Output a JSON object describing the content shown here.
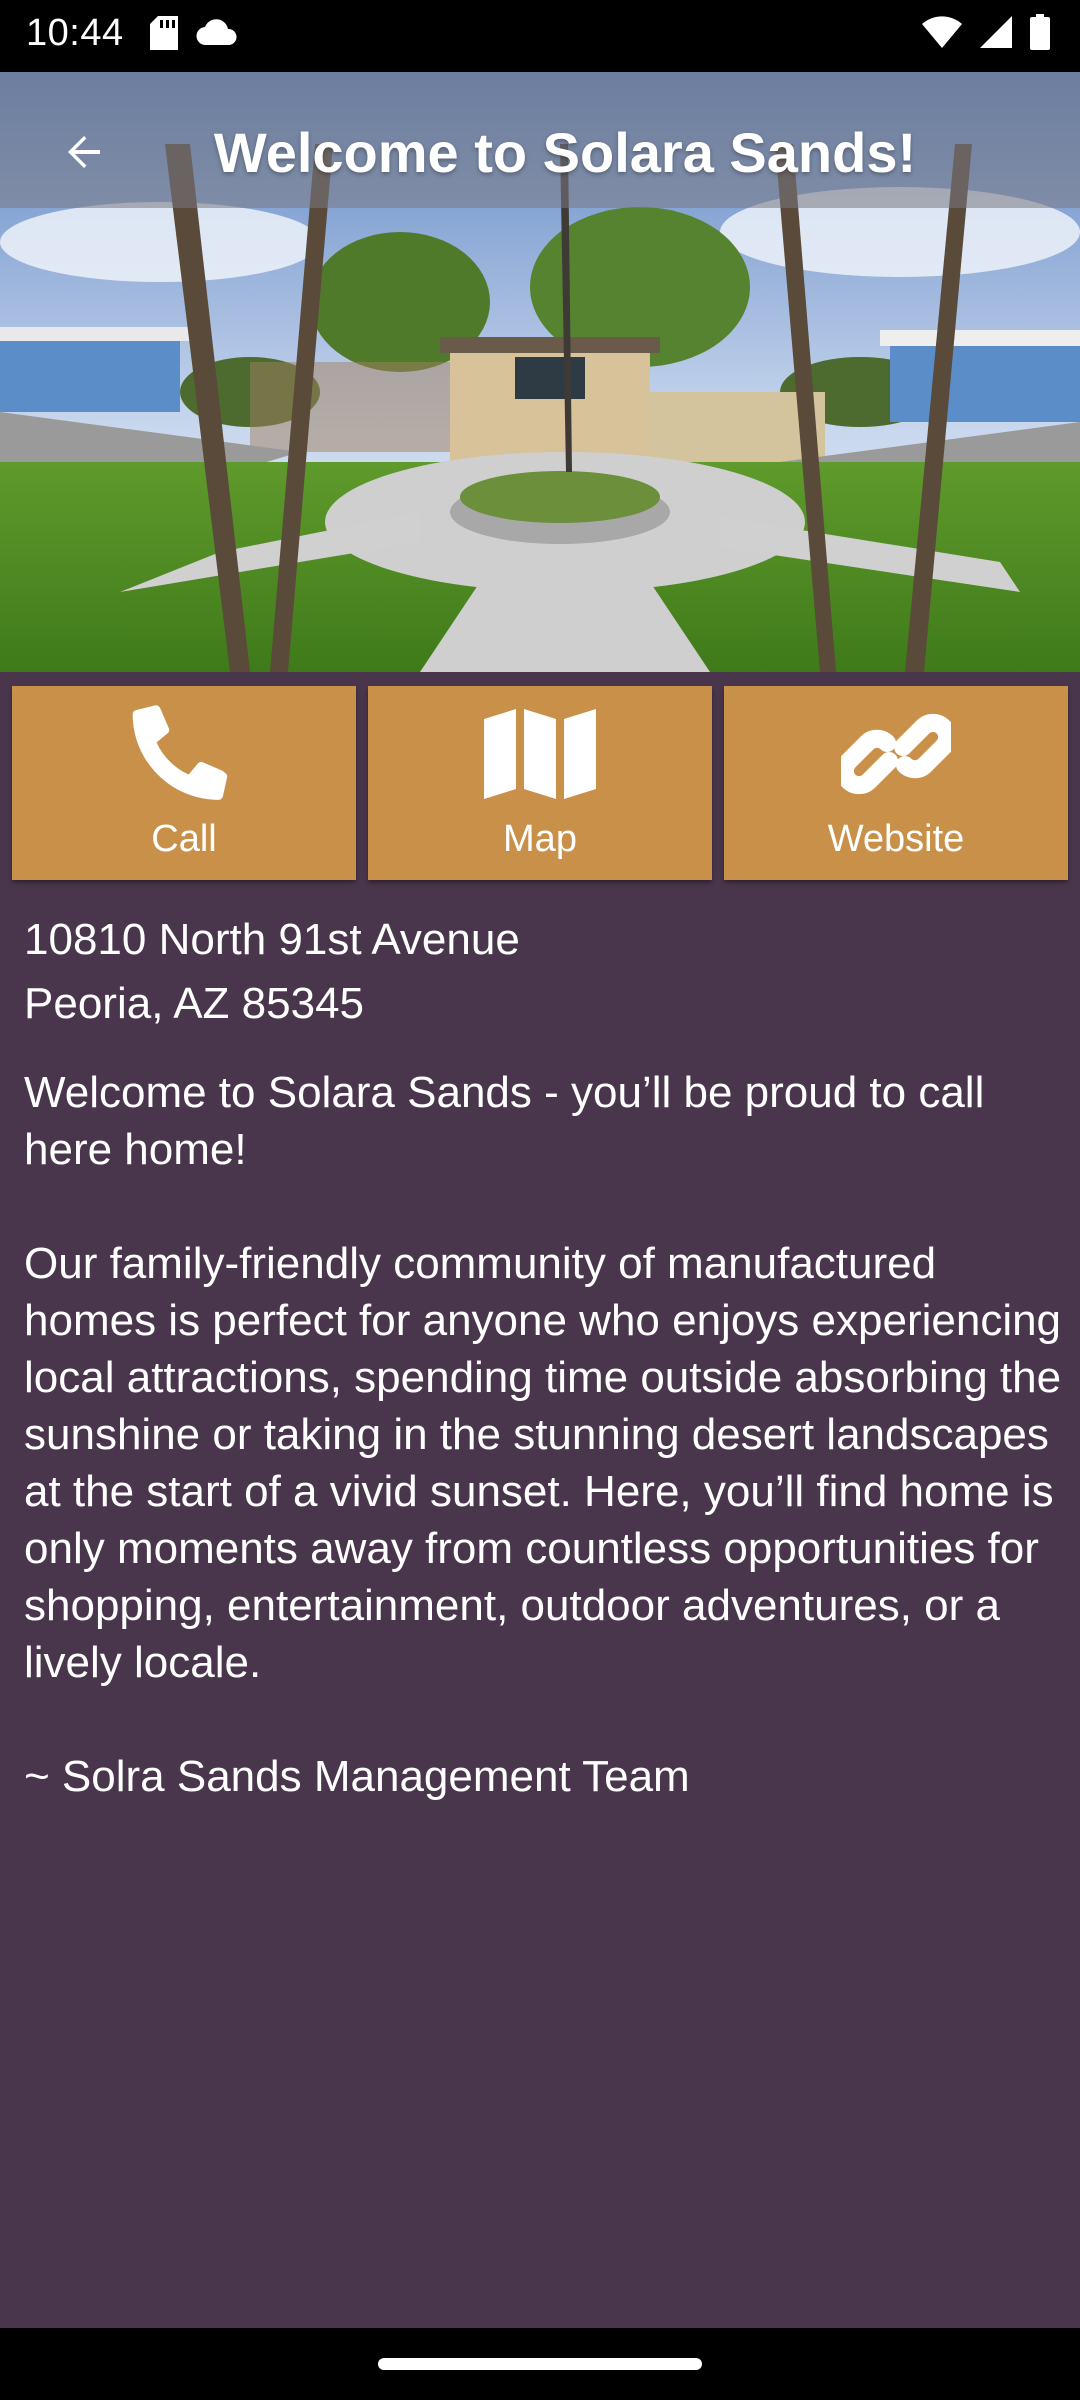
{
  "status_bar": {
    "time": "10:44",
    "icons": [
      "sd-card-icon",
      "cloud-icon",
      "wifi-icon",
      "signal-icon",
      "battery-icon"
    ]
  },
  "app_bar": {
    "title": "Welcome to Solara Sands!",
    "back_icon": "arrow-back-icon"
  },
  "hero": {
    "image": "community-entrance-photo"
  },
  "actions": [
    {
      "label": "Call",
      "icon": "phone-icon"
    },
    {
      "label": "Map",
      "icon": "map-icon"
    },
    {
      "label": "Website",
      "icon": "link-icon"
    }
  ],
  "address": {
    "line1": "10810 North 91st Avenue",
    "line2": "Peoria, AZ 85345"
  },
  "description": {
    "intro": "Welcome to Solara Sands - you’ll be proud to call here home!",
    "body": "Our family-friendly community of manufactured homes is perfect for anyone who enjoys experiencing local attractions, spending time outside absorbing the sunshine or taking in the stunning desert landscapes at the start of a vivid sunset. Here, you’ll find home is only moments away from countless opportunities for shopping, entertainment, outdoor adventures, or a lively locale.",
    "signature": "~ Solra Sands Management Team"
  },
  "colors": {
    "background": "#4a364c",
    "button": "#c9904a",
    "text": "#ffffff"
  }
}
